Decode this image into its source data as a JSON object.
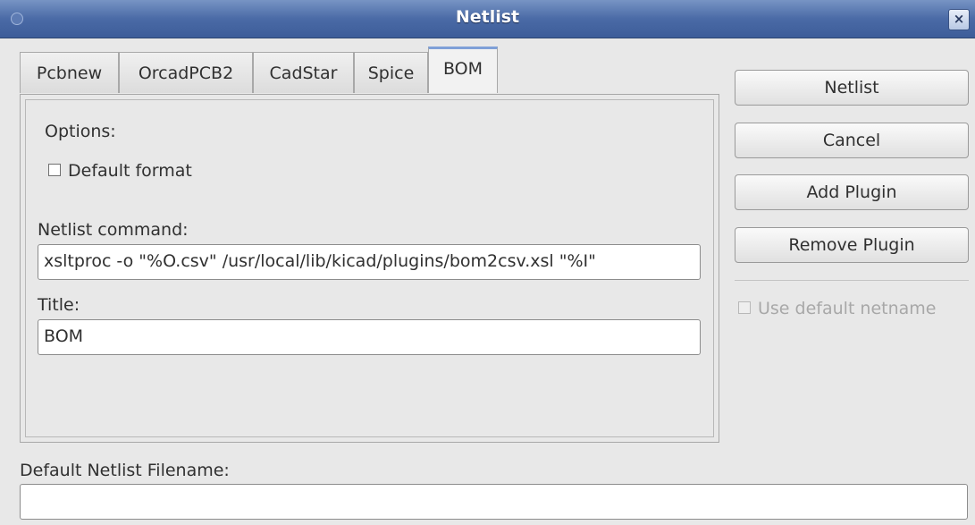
{
  "window": {
    "title": "Netlist",
    "close_glyph": "×"
  },
  "tabs": [
    {
      "label": "Pcbnew",
      "active": false
    },
    {
      "label": "OrcadPCB2",
      "active": false
    },
    {
      "label": "CadStar",
      "active": false
    },
    {
      "label": "Spice",
      "active": false
    },
    {
      "label": "BOM",
      "active": true
    }
  ],
  "bom_panel": {
    "options_label": "Options:",
    "default_format_label": "Default format",
    "default_format_checked": false,
    "netlist_command_label": "Netlist command:",
    "netlist_command_value": "xsltproc -o \"%O.csv\" /usr/local/lib/kicad/plugins/bom2csv.xsl \"%I\"",
    "title_label": "Title:",
    "title_value": "BOM"
  },
  "buttons": {
    "netlist": "Netlist",
    "cancel": "Cancel",
    "add_plugin": "Add Plugin",
    "remove_plugin": "Remove Plugin"
  },
  "use_default_netname": {
    "label": "Use default netname",
    "checked": false,
    "enabled": false
  },
  "footer": {
    "filename_label": "Default Netlist Filename:",
    "filename_value": ""
  }
}
